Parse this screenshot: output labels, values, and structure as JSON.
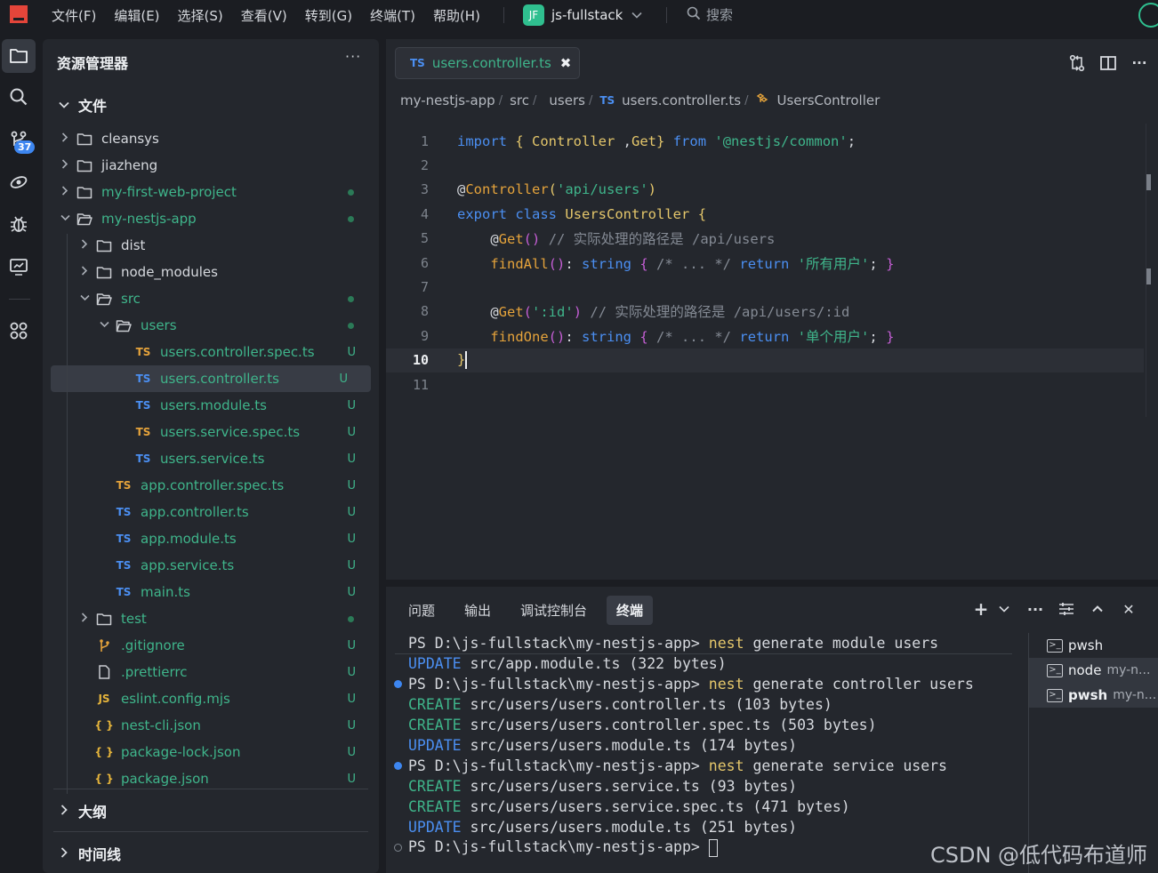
{
  "menubar": {
    "items": [
      "文件(F)",
      "编辑(E)",
      "选择(S)",
      "查看(V)",
      "转到(G)",
      "终端(T)",
      "帮助(H)"
    ],
    "project_badge": "JF",
    "project_name": "js-fullstack",
    "search_label": "搜索"
  },
  "activity_bar": {
    "scm_badge": "37",
    "icons": [
      "explorer-icon",
      "search-icon",
      "source-control-icon",
      "remote-icon",
      "debug-icon",
      "preview-icon",
      "extensions-icon"
    ]
  },
  "explorer": {
    "title": "资源管理器",
    "more": "···",
    "files_section": "文件",
    "outline_section": "大纲",
    "timeline_section": "时间线",
    "tree": [
      {
        "label": "cleansys",
        "type": "folder",
        "depth": 0,
        "open": false,
        "color": "white",
        "status": ""
      },
      {
        "label": "jiazheng",
        "type": "folder",
        "depth": 0,
        "open": false,
        "color": "white",
        "status": ""
      },
      {
        "label": "my-first-web-project",
        "type": "folder",
        "depth": 0,
        "open": false,
        "color": "green",
        "status": "dot"
      },
      {
        "label": "my-nestjs-app",
        "type": "folder",
        "depth": 0,
        "open": true,
        "color": "green",
        "status": "dot"
      },
      {
        "label": "dist",
        "type": "folder",
        "depth": 1,
        "open": false,
        "color": "white",
        "status": ""
      },
      {
        "label": "node_modules",
        "type": "folder",
        "depth": 1,
        "open": false,
        "color": "white",
        "status": ""
      },
      {
        "label": "src",
        "type": "folder",
        "depth": 1,
        "open": true,
        "color": "green",
        "status": "dot"
      },
      {
        "label": "users",
        "type": "folder",
        "depth": 2,
        "open": true,
        "color": "green",
        "status": "dot"
      },
      {
        "label": "users.controller.spec.ts",
        "type": "ts-test",
        "depth": 3,
        "color": "green",
        "status": "U"
      },
      {
        "label": "users.controller.ts",
        "type": "ts",
        "depth": 3,
        "color": "green",
        "status": "U",
        "selected": true
      },
      {
        "label": "users.module.ts",
        "type": "ts",
        "depth": 3,
        "color": "green",
        "status": "U"
      },
      {
        "label": "users.service.spec.ts",
        "type": "ts-test",
        "depth": 3,
        "color": "green",
        "status": "U"
      },
      {
        "label": "users.service.ts",
        "type": "ts",
        "depth": 3,
        "color": "green",
        "status": "U"
      },
      {
        "label": "app.controller.spec.ts",
        "type": "ts-test",
        "depth": 2,
        "color": "green",
        "status": "U"
      },
      {
        "label": "app.controller.ts",
        "type": "ts",
        "depth": 2,
        "color": "green",
        "status": "U"
      },
      {
        "label": "app.module.ts",
        "type": "ts",
        "depth": 2,
        "color": "green",
        "status": "U"
      },
      {
        "label": "app.service.ts",
        "type": "ts",
        "depth": 2,
        "color": "green",
        "status": "U"
      },
      {
        "label": "main.ts",
        "type": "ts",
        "depth": 2,
        "color": "green",
        "status": "U"
      },
      {
        "label": "test",
        "type": "folder",
        "depth": 1,
        "open": false,
        "color": "green",
        "status": "dot"
      },
      {
        "label": ".gitignore",
        "type": "git",
        "depth": 1,
        "color": "green",
        "status": "U"
      },
      {
        "label": ".prettierrc",
        "type": "file",
        "depth": 1,
        "color": "green",
        "status": "U"
      },
      {
        "label": "eslint.config.mjs",
        "type": "js",
        "depth": 1,
        "color": "green",
        "status": "U"
      },
      {
        "label": "nest-cli.json",
        "type": "json",
        "depth": 1,
        "color": "green",
        "status": "U"
      },
      {
        "label": "package-lock.json",
        "type": "json",
        "depth": 1,
        "color": "green",
        "status": "U"
      },
      {
        "label": "package.json",
        "type": "json",
        "depth": 1,
        "color": "green",
        "status": "U"
      }
    ]
  },
  "editor": {
    "tab": {
      "lang": "TS",
      "name": "users.controller.ts",
      "close": "✖"
    },
    "breadcrumbs": [
      "my-nestjs-app",
      "src",
      "users",
      "users.controller.ts",
      "UsersController"
    ],
    "breadcrumb_lang": "TS",
    "current_line": 10,
    "lines": [
      [
        [
          "kw",
          "import"
        ],
        [
          "pu",
          " "
        ],
        [
          "br1",
          "{"
        ],
        [
          "ty",
          " Controller "
        ],
        [
          "pu",
          ","
        ],
        [
          "ty",
          "Get"
        ],
        [
          "br1",
          "}"
        ],
        [
          "pu",
          " "
        ],
        [
          "kw",
          "from"
        ],
        [
          "pu",
          " "
        ],
        [
          "st",
          "'@nestjs/common'"
        ],
        [
          "pu",
          ";"
        ]
      ],
      [],
      [
        [
          "pu",
          "@"
        ],
        [
          "fn",
          "Controller"
        ],
        [
          "br1",
          "("
        ],
        [
          "st",
          "'api/users'"
        ],
        [
          "br1",
          ")"
        ]
      ],
      [
        [
          "kw",
          "export"
        ],
        [
          "pu",
          " "
        ],
        [
          "kw",
          "class"
        ],
        [
          "pu",
          " "
        ],
        [
          "ty",
          "UsersController"
        ],
        [
          "pu",
          " "
        ],
        [
          "br1",
          "{"
        ]
      ],
      [
        [
          "pu",
          "    @"
        ],
        [
          "fn",
          "Get"
        ],
        [
          "br2",
          "()"
        ],
        [
          "pu",
          " "
        ],
        [
          "cm",
          "// 实际处理的路径是 /api/users"
        ]
      ],
      [
        [
          "pu",
          "    "
        ],
        [
          "fn",
          "findAll"
        ],
        [
          "br2",
          "()"
        ],
        [
          "pu",
          ": "
        ],
        [
          "kw",
          "string"
        ],
        [
          "pu",
          " "
        ],
        [
          "br2",
          "{"
        ],
        [
          "pu",
          " "
        ],
        [
          "cm",
          "/* ... */"
        ],
        [
          "pu",
          " "
        ],
        [
          "kw",
          "return"
        ],
        [
          "pu",
          " "
        ],
        [
          "st",
          "'所有用户'"
        ],
        [
          "pu",
          "; "
        ],
        [
          "br2",
          "}"
        ]
      ],
      [],
      [
        [
          "pu",
          "    @"
        ],
        [
          "fn",
          "Get"
        ],
        [
          "br2",
          "("
        ],
        [
          "st",
          "':id'"
        ],
        [
          "br2",
          ")"
        ],
        [
          "pu",
          " "
        ],
        [
          "cm",
          "// 实际处理的路径是 /api/users/:id"
        ]
      ],
      [
        [
          "pu",
          "    "
        ],
        [
          "fn",
          "findOne"
        ],
        [
          "br2",
          "()"
        ],
        [
          "pu",
          ": "
        ],
        [
          "kw",
          "string"
        ],
        [
          "pu",
          " "
        ],
        [
          "br2",
          "{"
        ],
        [
          "pu",
          " "
        ],
        [
          "cm",
          "/* ... */"
        ],
        [
          "pu",
          " "
        ],
        [
          "kw",
          "return"
        ],
        [
          "pu",
          " "
        ],
        [
          "st",
          "'单个用户'"
        ],
        [
          "pu",
          "; "
        ],
        [
          "br2",
          "}"
        ]
      ],
      [
        [
          "br1",
          "}"
        ]
      ],
      []
    ]
  },
  "panel": {
    "tabs": [
      "问题",
      "输出",
      "调试控制台",
      "终端"
    ],
    "active_tab": "终端",
    "actions": {
      "add": "+",
      "chevron": "⌄",
      "more": "···",
      "close": "✕"
    },
    "terminal_lines": [
      {
        "mark": "",
        "parts": [
          [
            "p",
            "PS D:\\js-fullstack\\my-nestjs-app> "
          ],
          [
            "cmd",
            "nest"
          ],
          [
            "p",
            " generate module users"
          ]
        ]
      },
      {
        "mark": "",
        "parts": [
          [
            "upd",
            "UPDATE"
          ],
          [
            "p",
            " src/app.module.ts (322 bytes)"
          ]
        ]
      },
      {
        "mark": "blue",
        "parts": [
          [
            "p",
            "PS D:\\js-fullstack\\my-nestjs-app> "
          ],
          [
            "cmd",
            "nest"
          ],
          [
            "p",
            " generate controller users"
          ]
        ]
      },
      {
        "mark": "",
        "parts": [
          [
            "cre",
            "CREATE"
          ],
          [
            "p",
            " src/users/users.controller.ts (103 bytes)"
          ]
        ]
      },
      {
        "mark": "",
        "parts": [
          [
            "cre",
            "CREATE"
          ],
          [
            "p",
            " src/users/users.controller.spec.ts (503 bytes)"
          ]
        ]
      },
      {
        "mark": "",
        "parts": [
          [
            "upd",
            "UPDATE"
          ],
          [
            "p",
            " src/users/users.module.ts (174 bytes)"
          ]
        ]
      },
      {
        "mark": "blue",
        "parts": [
          [
            "p",
            "PS D:\\js-fullstack\\my-nestjs-app> "
          ],
          [
            "cmd",
            "nest"
          ],
          [
            "p",
            " generate service users"
          ]
        ]
      },
      {
        "mark": "",
        "parts": [
          [
            "cre",
            "CREATE"
          ],
          [
            "p",
            " src/users/users.service.ts (93 bytes)"
          ]
        ]
      },
      {
        "mark": "",
        "parts": [
          [
            "cre",
            "CREATE"
          ],
          [
            "p",
            " src/users/users.service.spec.ts (471 bytes)"
          ]
        ]
      },
      {
        "mark": "",
        "parts": [
          [
            "upd",
            "UPDATE"
          ],
          [
            "p",
            " src/users/users.module.ts (251 bytes)"
          ]
        ]
      },
      {
        "mark": "ring",
        "parts": [
          [
            "p",
            "PS D:\\js-fullstack\\my-nestjs-app> "
          ],
          [
            "cursor",
            ""
          ]
        ]
      }
    ],
    "terminal_list": [
      {
        "name": "pwsh",
        "sub": "",
        "bold": false,
        "selected": false
      },
      {
        "name": "node",
        "sub": "my-n...",
        "bold": false,
        "selected": true
      },
      {
        "name": "pwsh",
        "sub": "my-n...",
        "bold": true,
        "selected": true
      }
    ]
  },
  "watermark": "CSDN @低代码布道师",
  "colors": {
    "accent_green": "#3fb58b",
    "accent_blue": "#3d86f0",
    "background": "#1b1d22",
    "panel_background": "#24272d"
  }
}
